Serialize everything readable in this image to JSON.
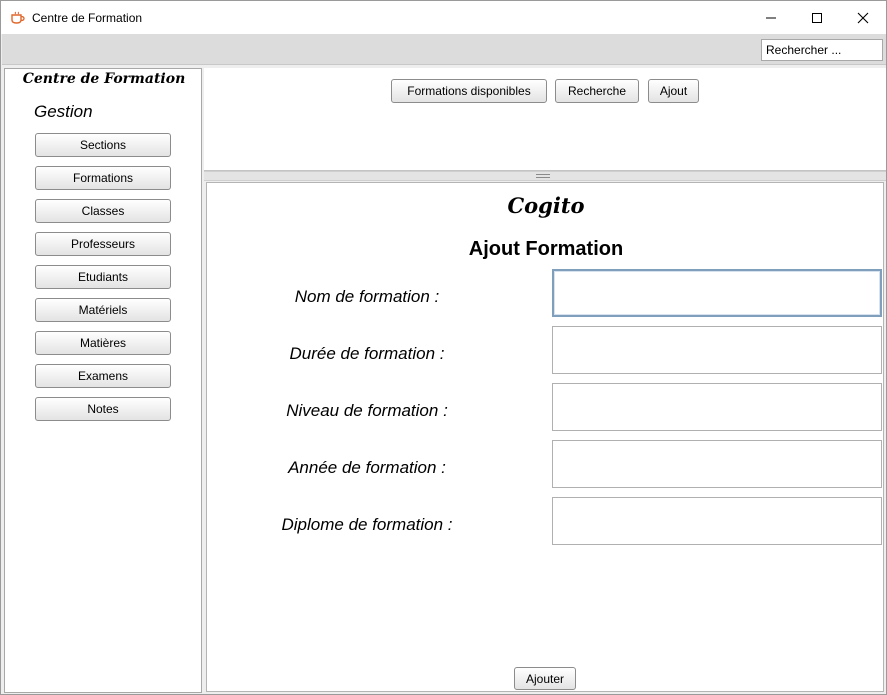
{
  "window": {
    "title": "Centre de Formation",
    "app_icon": "cup-icon",
    "controls": {
      "minimize": "—",
      "maximize": "☐",
      "close": "✕"
    }
  },
  "toolbar": {
    "search_placeholder": "Rechercher ..."
  },
  "sidebar": {
    "title": "Centre de Formation",
    "section_label": "Gestion",
    "items": [
      {
        "label": "Sections"
      },
      {
        "label": "Formations"
      },
      {
        "label": "Classes"
      },
      {
        "label": "Professeurs"
      },
      {
        "label": "Etudiants"
      },
      {
        "label": "Matériels"
      },
      {
        "label": "Matières"
      },
      {
        "label": "Examens"
      },
      {
        "label": "Notes"
      }
    ]
  },
  "top_panel": {
    "buttons": [
      {
        "label": "Formations disponibles"
      },
      {
        "label": "Recherche"
      },
      {
        "label": "Ajout"
      }
    ]
  },
  "form": {
    "brand": "Cogito",
    "title": "Ajout Formation",
    "fields": [
      {
        "label": "Nom de formation :",
        "value": ""
      },
      {
        "label": "Durée de formation :",
        "value": ""
      },
      {
        "label": "Niveau de formation :",
        "value": ""
      },
      {
        "label": "Année de formation :",
        "value": ""
      },
      {
        "label": "Diplome de formation :",
        "value": ""
      }
    ],
    "submit_label": "Ajouter"
  }
}
